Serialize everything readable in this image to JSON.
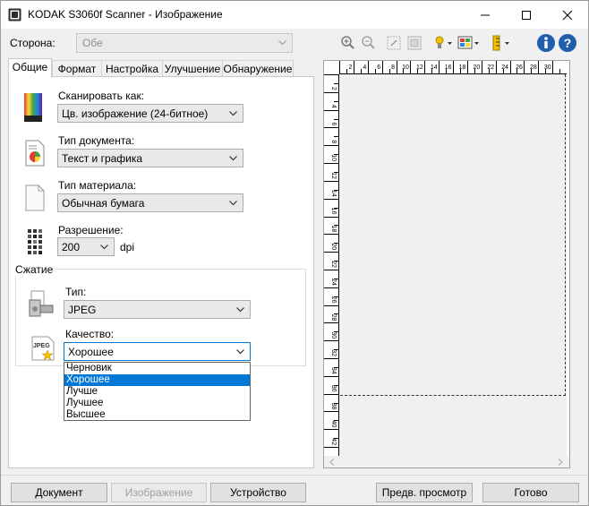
{
  "window": {
    "title": "KODAK S3060f Scanner - Изображение"
  },
  "side": {
    "label": "Сторона:",
    "value": "Обе"
  },
  "tabs": [
    {
      "label": "Общие"
    },
    {
      "label": "Формат"
    },
    {
      "label": "Настройка"
    },
    {
      "label": "Улучшение"
    },
    {
      "label": "Обнаружение"
    }
  ],
  "general": {
    "scan_as": {
      "label": "Сканировать как:",
      "value": "Цв. изображение (24-битное)"
    },
    "doc_type": {
      "label": "Тип документа:",
      "value": "Текст и графика"
    },
    "media_type": {
      "label": "Тип материала:",
      "value": "Обычная бумага"
    },
    "resolution": {
      "label": "Разрешение:",
      "value": "200",
      "unit": "dpi"
    },
    "compression": {
      "group_title": "Сжатие",
      "type": {
        "label": "Тип:",
        "value": "JPEG"
      },
      "quality": {
        "label": "Качество:",
        "value": "Хорошее",
        "options": [
          "Черновик",
          "Хорошее",
          "Лучше",
          "Лучшее",
          "Высшее"
        ],
        "highlighted_index": 1
      }
    }
  },
  "ruler": {
    "top_ticks": [
      "2",
      "4",
      "6",
      "8",
      "10",
      "12",
      "14",
      "16",
      "18",
      "20",
      "22",
      "24",
      "26",
      "28",
      "30"
    ],
    "left_ticks": [
      "2",
      "4",
      "6",
      "8",
      "10",
      "12",
      "14",
      "16",
      "18",
      "20",
      "22",
      "24",
      "26",
      "28",
      "30",
      "32",
      "34",
      "36",
      "38",
      "40",
      "42"
    ]
  },
  "toolbar": {
    "icons": [
      "zoom-in-icon",
      "zoom-out-icon",
      "rotate-icon",
      "crop-icon",
      "lamp-icon",
      "color-settings-icon",
      "ruler-icon",
      "info-icon",
      "help-icon"
    ]
  },
  "buttons": {
    "document": "Документ",
    "image": "Изображение",
    "device": "Устройство",
    "preview": "Предв. просмотр",
    "done": "Готово"
  },
  "colors": {
    "selection": "#0078d7",
    "info_blue": "#1f5fae"
  }
}
